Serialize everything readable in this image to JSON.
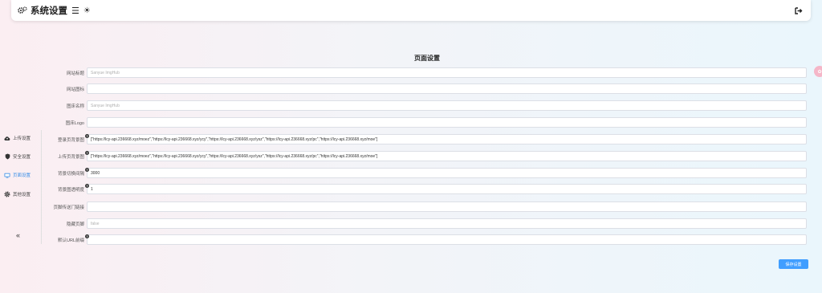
{
  "header": {
    "title": "系统设置",
    "gear_icon": "gears-icon",
    "menu_icon": "hamburger-icon",
    "theme_icon": "sun-icon",
    "logout_icon": "logout-icon"
  },
  "main": {
    "title": "页面设置",
    "fields": [
      {
        "label": "网站标题",
        "value": "",
        "placeholder": "Sanyue ImgHub",
        "help": false
      },
      {
        "label": "网站图标",
        "value": "",
        "placeholder": "",
        "help": false
      },
      {
        "label": "图床名称",
        "value": "",
        "placeholder": "Sanyue ImgHub",
        "help": false
      },
      {
        "label": "图床Logo",
        "value": "",
        "placeholder": "",
        "help": false
      },
      {
        "label": "登录页背景图",
        "value": "[\"https://lcy-api.236668.xyz/moez\",\"https://lcy-api.236668.xyz/ycy\",\"https://lcy-api.236668.xyz/ysz\",\"https://lcy-api.236668.xyz/pc\",\"https://lcy-api.236668.xyz/moe\"]",
        "placeholder": "",
        "help": true
      },
      {
        "label": "上传页背景图",
        "value": "[\"https://lcy-api.236668.xyz/moez\",\"https://lcy-api.236668.xyz/ycy\",\"https://lcy-api.236668.xyz/ysz\",\"https://lcy-api.236668.xyz/pc\",\"https://lcy-api.236668.xyz/moe\"]",
        "placeholder": "",
        "help": true
      },
      {
        "label": "背景切换间隔",
        "value": "3000",
        "placeholder": "",
        "help": true
      },
      {
        "label": "背景图透明度",
        "value": "1",
        "placeholder": "",
        "help": true
      },
      {
        "label": "页脚传送门链接",
        "value": "",
        "placeholder": "",
        "help": false
      },
      {
        "label": "隐藏页脚",
        "value": "",
        "placeholder": "false",
        "help": false
      },
      {
        "label": "默认URL前缀",
        "value": "",
        "placeholder": "",
        "help": true
      }
    ],
    "help_glyph": "?",
    "save_label": "保存设置"
  },
  "sidebar": {
    "items": [
      {
        "label": "上传设置",
        "icon": "cloud-upload-icon"
      },
      {
        "label": "安全设置",
        "icon": "shield-icon"
      },
      {
        "label": "页面设置",
        "icon": "monitor-icon",
        "active": true
      },
      {
        "label": "其他设置",
        "icon": "gear-icon"
      }
    ],
    "collapse_glyph": "«"
  },
  "colors": {
    "accent": "#409eff",
    "active_item": "#3a8ee6"
  }
}
